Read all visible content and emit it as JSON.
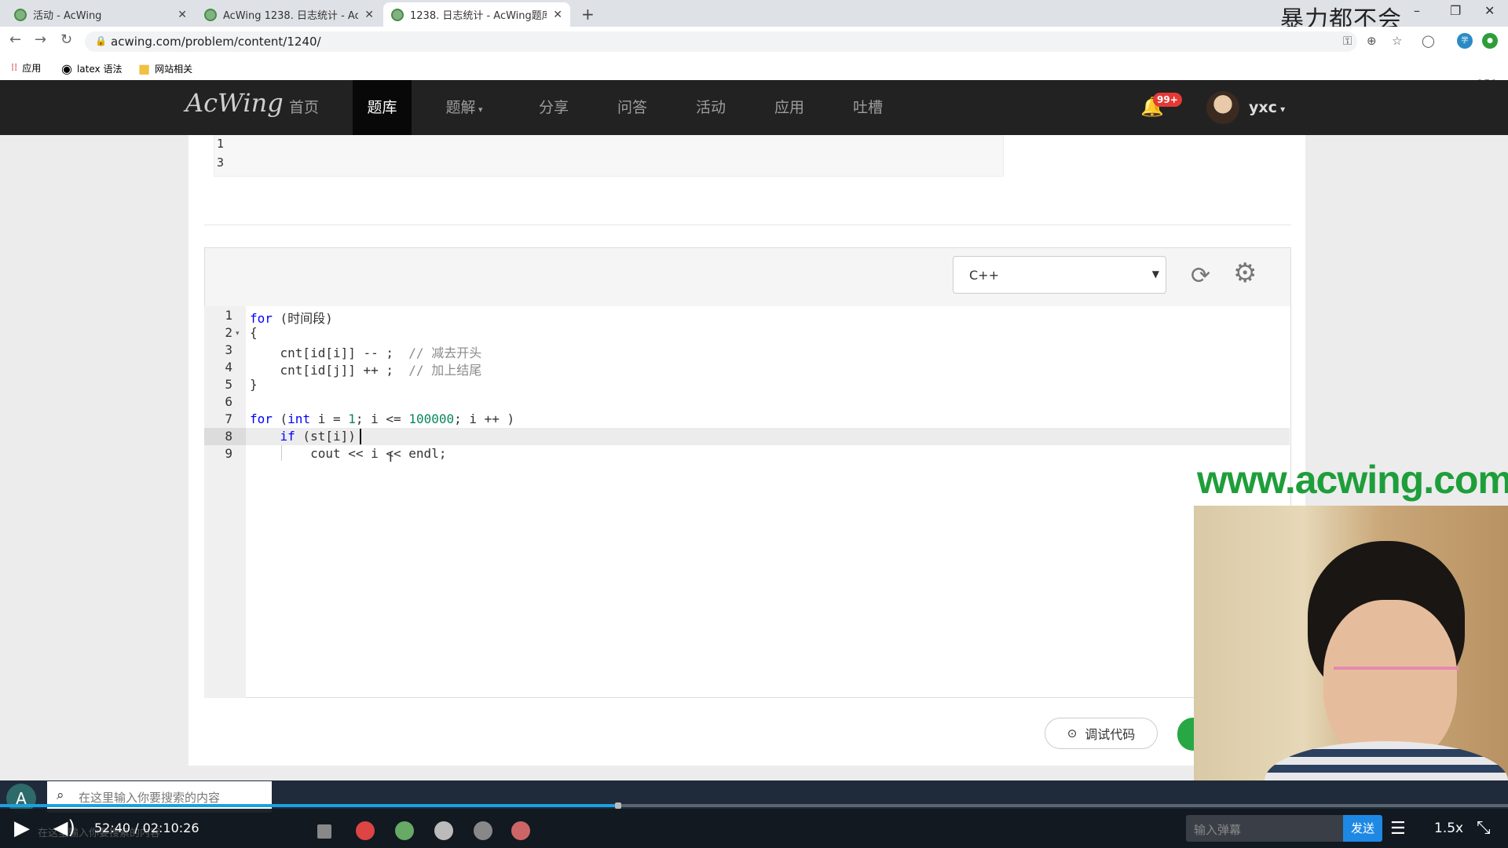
{
  "browser": {
    "tabs": [
      {
        "title": "活动 - AcWing"
      },
      {
        "title": "AcWing 1238. 日志统计 - AcWi"
      },
      {
        "title": "1238. 日志统计 - AcWing题库"
      }
    ],
    "url": "acwing.com/problem/content/1240/",
    "bookmarks": [
      "应用",
      "latex 语法",
      "网站相关"
    ],
    "overlay_title": "暴力都不会"
  },
  "site": {
    "logo": "AcWing",
    "nav": [
      "首页",
      "题库",
      "题解",
      "分享",
      "问答",
      "活动",
      "应用",
      "吐槽"
    ],
    "active_nav": "题库",
    "notifications": "99+",
    "username": "yxc",
    "corner_text": "151"
  },
  "sample_output": [
    "1",
    "3"
  ],
  "editor": {
    "language": "C++",
    "line_numbers": [
      "1",
      "2",
      "3",
      "4",
      "5",
      "6",
      "7",
      "8",
      "9"
    ],
    "current_line": 8
  },
  "buttons": {
    "debug": "调试代码"
  },
  "video": {
    "watermark": "www.acwing.com",
    "time": "52:40 / 02:10:26",
    "progress": 0.41,
    "search_placeholder": "在这里输入你要搜索的内容",
    "danmu_placeholder": "输入弹幕",
    "send": "发送",
    "speed": "1.5x",
    "ghost_text": "在这里输入你要搜索的内容"
  },
  "colors": {
    "keyword": "#0000ff",
    "number": "#098658",
    "comment": "#8b8b8b",
    "nav_bg": "#222222",
    "accent": "#1ba1e2"
  }
}
